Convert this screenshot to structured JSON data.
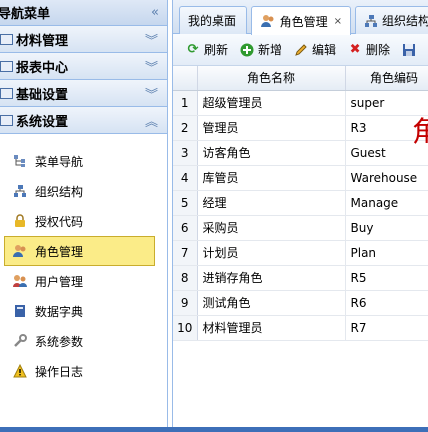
{
  "nav": {
    "title": "导航菜单",
    "groups": [
      {
        "label": "材料管理",
        "expanded": false
      },
      {
        "label": "报表中心",
        "expanded": false
      },
      {
        "label": "基础设置",
        "expanded": false
      },
      {
        "label": "系统设置",
        "expanded": true
      }
    ],
    "items": [
      {
        "label": "菜单导航",
        "icon": "tree-icon"
      },
      {
        "label": "组织结构",
        "icon": "org-icon"
      },
      {
        "label": "授权代码",
        "icon": "lock-icon"
      },
      {
        "label": "角色管理",
        "icon": "role-icon",
        "active": true
      },
      {
        "label": "用户管理",
        "icon": "users-icon"
      },
      {
        "label": "数据字典",
        "icon": "book-icon"
      },
      {
        "label": "系统参数",
        "icon": "wrench-icon"
      },
      {
        "label": "操作日志",
        "icon": "warning-icon"
      }
    ]
  },
  "tabs": [
    {
      "label": "我的桌面"
    },
    {
      "label": "角色管理",
      "close": "×",
      "active": true
    },
    {
      "label": "组织结构"
    }
  ],
  "toolbar": {
    "refresh": "刷新",
    "add": "新增",
    "edit": "编辑",
    "delete": "删除"
  },
  "grid": {
    "columns": [
      "角色名称",
      "角色编码"
    ],
    "rows": [
      {
        "no": "1",
        "name": "超级管理员",
        "code": "super"
      },
      {
        "no": "2",
        "name": "管理员",
        "code": "R3"
      },
      {
        "no": "3",
        "name": "访客角色",
        "code": "Guest"
      },
      {
        "no": "4",
        "name": "库管员",
        "code": "Warehouse"
      },
      {
        "no": "5",
        "name": "经理",
        "code": "Manage"
      },
      {
        "no": "6",
        "name": "采购员",
        "code": "Buy"
      },
      {
        "no": "7",
        "name": "计划员",
        "code": "Plan"
      },
      {
        "no": "8",
        "name": "进销存角色",
        "code": "R5"
      },
      {
        "no": "9",
        "name": "测试角色",
        "code": "R6"
      },
      {
        "no": "10",
        "name": "材料管理员",
        "code": "R7"
      }
    ]
  },
  "overlay_char": "角",
  "colors": {
    "accent": "#99bbe8",
    "active_item": "#fbec88",
    "overlay": "#c40000"
  }
}
